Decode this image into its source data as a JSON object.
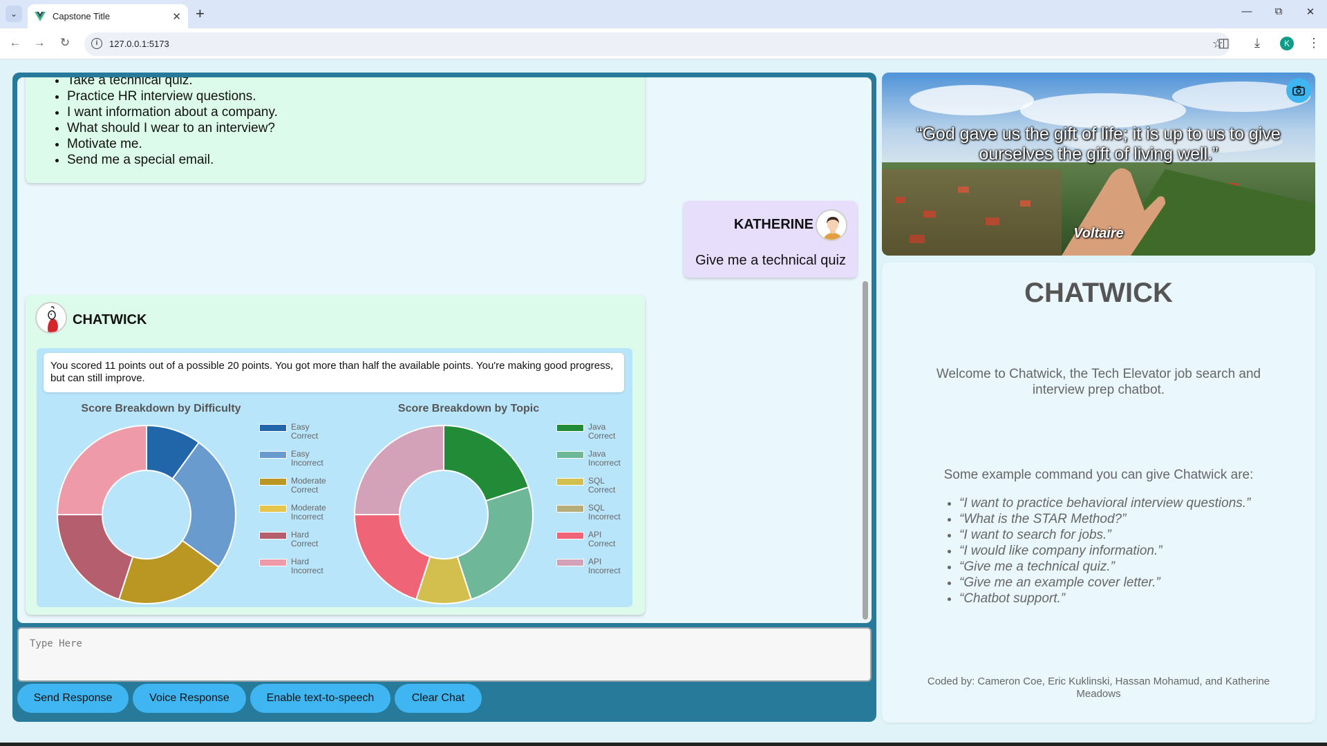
{
  "browser": {
    "tab_title": "Capstone Title",
    "url": "127.0.0.1:5173",
    "profile_initial": "K"
  },
  "chat": {
    "intro_options": [
      "Take a technical quiz.",
      "Practice HR interview questions.",
      "I want information about a company.",
      "What should I wear to an interview?",
      "Motivate me.",
      "Send me a special email."
    ],
    "user_name": "KATHERINE",
    "user_message": "Give me a technical quiz",
    "bot_name": "CHATWICK",
    "score_text": "You scored 11 points out of a possible 20 points. You got more than half the available points. You're making good progress, but can still improve."
  },
  "chart_data": [
    {
      "type": "pie",
      "title": "Score Breakdown by Difficulty",
      "categories": [
        "Easy Correct",
        "Easy Incorrect",
        "Moderate Correct",
        "Moderate Incorrect",
        "Hard Correct",
        "Hard Incorrect"
      ],
      "legend_lines": [
        [
          "Easy",
          "Correct"
        ],
        [
          "Easy",
          "Incorrect"
        ],
        [
          "Moderate",
          "Correct"
        ],
        [
          "Moderate",
          "Incorrect"
        ],
        [
          "Hard",
          "Correct"
        ],
        [
          "Hard",
          "Incorrect"
        ]
      ],
      "values": [
        2,
        5,
        4,
        0,
        4,
        5
      ],
      "colors": [
        "#2166a8",
        "#6a9bcf",
        "#ba9623",
        "#e6c64a",
        "#b55f6e",
        "#ee9aa8"
      ],
      "legend": "right",
      "donut": true
    },
    {
      "type": "pie",
      "title": "Score Breakdown by Topic",
      "categories": [
        "Java Correct",
        "Java Incorrect",
        "SQL Correct",
        "SQL Incorrect",
        "API Correct",
        "API Incorrect"
      ],
      "legend_lines": [
        [
          "Java",
          "Correct"
        ],
        [
          "Java",
          "Incorrect"
        ],
        [
          "SQL",
          "Correct"
        ],
        [
          "SQL",
          "Incorrect"
        ],
        [
          "API",
          "Correct"
        ],
        [
          "API",
          "Incorrect"
        ]
      ],
      "values": [
        4,
        5,
        2,
        0,
        4,
        5
      ],
      "colors": [
        "#228b37",
        "#6eb899",
        "#d2bf4d",
        "#b7ad78",
        "#ef6477",
        "#d3a2b9"
      ],
      "legend": "right",
      "donut": true
    }
  ],
  "composer": {
    "placeholder": "Type Here",
    "buttons": [
      "Send Response",
      "Voice Response",
      "Enable text-to-speech",
      "Clear Chat"
    ]
  },
  "quote": {
    "text": "“God gave us the gift of life; it is up to us to give ourselves the gift of living well.”",
    "author": "Voltaire"
  },
  "info": {
    "title": "CHATWICK",
    "welcome": "Welcome to Chatwick, the Tech Elevator job search and interview prep chatbot.",
    "examples_label": "Some example command you can give Chatwick are:",
    "examples": [
      "“I want to practice behavioral interview questions.”",
      "“What is the STAR Method?”",
      "“I want to search for jobs.”",
      "“I would like company information.”",
      "“Give me a technical quiz.”",
      "“Give me an example cover letter.”",
      "“Chatbot support.”"
    ],
    "credits": "Coded by: Cameron Coe, Eric Kuklinski, Hassan Mohamud, and Katherine Meadows"
  },
  "colors": {
    "panel": "#287a9a",
    "accent_button": "#3fb6f2",
    "bot_bubble": "#dcfbea",
    "user_bubble": "#e7defb"
  }
}
